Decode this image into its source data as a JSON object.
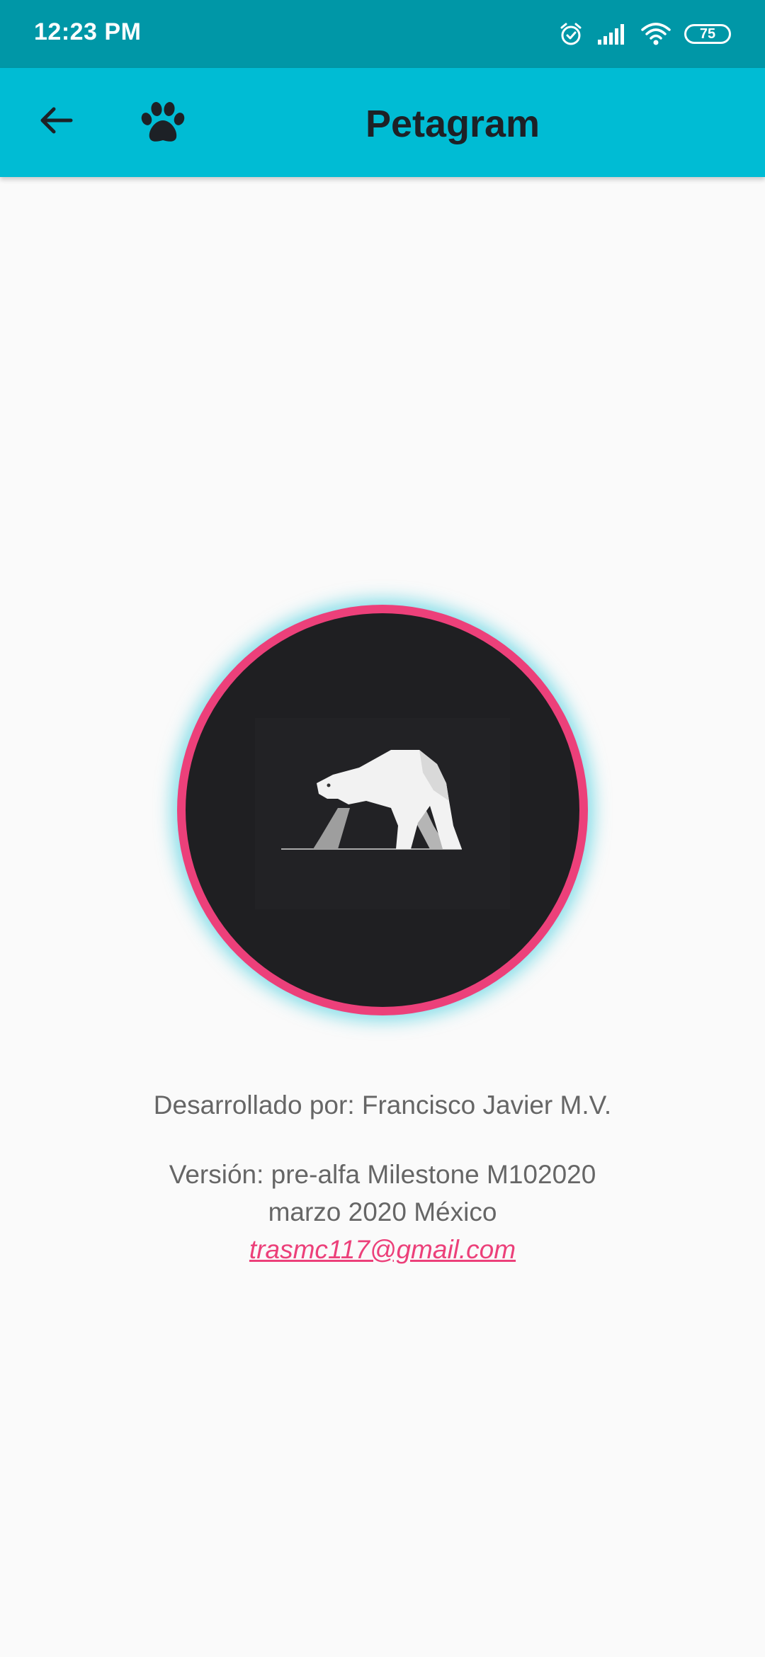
{
  "status_bar": {
    "time": "12:23 PM",
    "battery": "75",
    "icons": [
      "alarm-icon",
      "signal-icon",
      "wifi-icon",
      "battery-icon"
    ]
  },
  "app_bar": {
    "title": "Petagram",
    "back_icon": "arrow-back-icon",
    "logo_icon": "paw-icon"
  },
  "about": {
    "avatar_icon": "polar-bear-logo",
    "developer": "Desarrollado por: Francisco Javier M.V.",
    "version": "Versión: pre-alfa Milestone M102020",
    "date_location": "marzo 2020 México",
    "email": "trasmc117@gmail.com"
  },
  "colors": {
    "status_bar": "#0097a7",
    "app_bar": "#00bcd4",
    "accent": "#ec407a",
    "avatar_bg": "#1f1f22",
    "text": "#666666"
  }
}
